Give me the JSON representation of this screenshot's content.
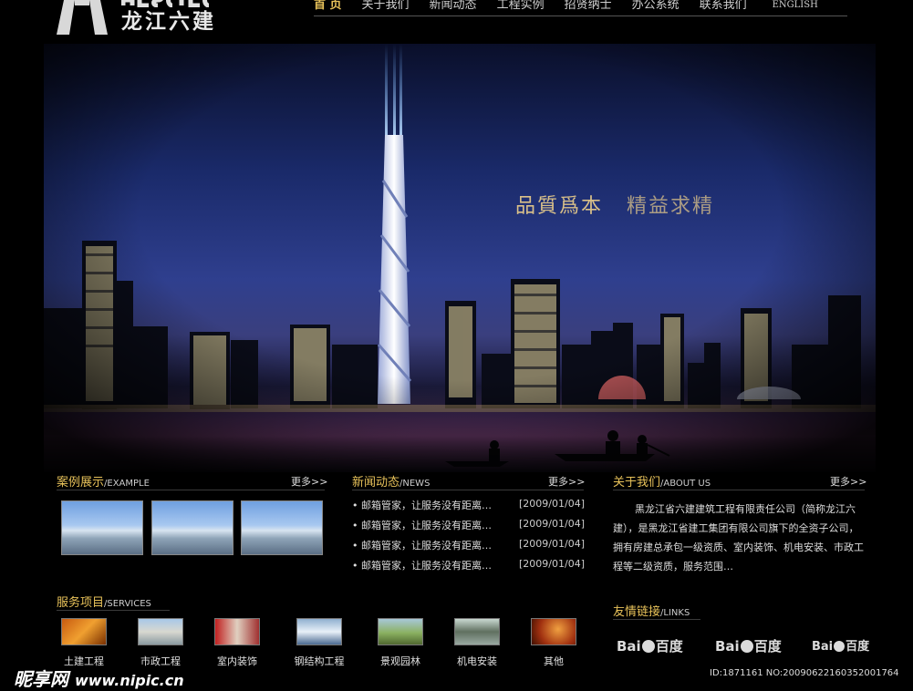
{
  "header": {
    "logo_latin": "HLSJC",
    "logo_text": "龙江六建",
    "nav": [
      {
        "label": "首 页",
        "active": true
      },
      {
        "label": "关于我们"
      },
      {
        "label": "新闻动态"
      },
      {
        "label": "工程实例"
      },
      {
        "label": "招贤纳士"
      },
      {
        "label": "办公系统"
      },
      {
        "label": "联系我们"
      },
      {
        "label": "ENGLISH"
      }
    ]
  },
  "banner": {
    "slogan_1": "品質爲本",
    "slogan_2": "精益求精"
  },
  "cases": {
    "title": "案例展示",
    "title_en": "/EXAMPLE",
    "more": "更多>>"
  },
  "news": {
    "title": "新闻动态",
    "title_en": "/NEWS",
    "more": "更多>>",
    "items": [
      {
        "text": "• 邮箱管家，让服务没有距离…",
        "date": "[2009/01/04]"
      },
      {
        "text": "• 邮箱管家，让服务没有距离…",
        "date": "[2009/01/04]"
      },
      {
        "text": "• 邮箱管家，让服务没有距离…",
        "date": "[2009/01/04]"
      },
      {
        "text": "• 邮箱管家，让服务没有距离…",
        "date": "[2009/01/04]"
      }
    ]
  },
  "about": {
    "title": "关于我们",
    "title_en": "/ABOUT US",
    "more": "更多>>",
    "text": "黑龙江省六建建筑工程有限责任公司（简称龙江六建），是黑龙江省建工集团有限公司旗下的全资子公司，拥有房建总承包一级资质、室内装饰、机电安装、市政工程等二级资质，服务范围…"
  },
  "services": {
    "title": "服务项目",
    "title_en": "/SERVICES",
    "items": [
      {
        "label": "土建工程",
        "icon": "construction-photo"
      },
      {
        "label": "市政工程",
        "icon": "municipal-photo"
      },
      {
        "label": "室内装饰",
        "icon": "interior-photo"
      },
      {
        "label": "钢结构工程",
        "icon": "steel-structure-photo"
      },
      {
        "label": "景观园林",
        "icon": "landscape-photo"
      },
      {
        "label": "机电安装",
        "icon": "electromechanical-photo"
      },
      {
        "label": "其他",
        "icon": "other-photo"
      }
    ]
  },
  "links": {
    "title": "友情链接",
    "title_en": "/LINKS",
    "items": [
      {
        "left": "Bai",
        "right": "百度"
      },
      {
        "left": "Bai",
        "right": "百度"
      },
      {
        "left": "Bai",
        "right": "百度"
      }
    ]
  },
  "watermark": {
    "brand": "昵享网",
    "url": "www.nipic.cn",
    "image_id": "ID:1871161 NO:20090622160352001764"
  },
  "colors": {
    "accent": "#e8c25a",
    "background": "#000000"
  }
}
